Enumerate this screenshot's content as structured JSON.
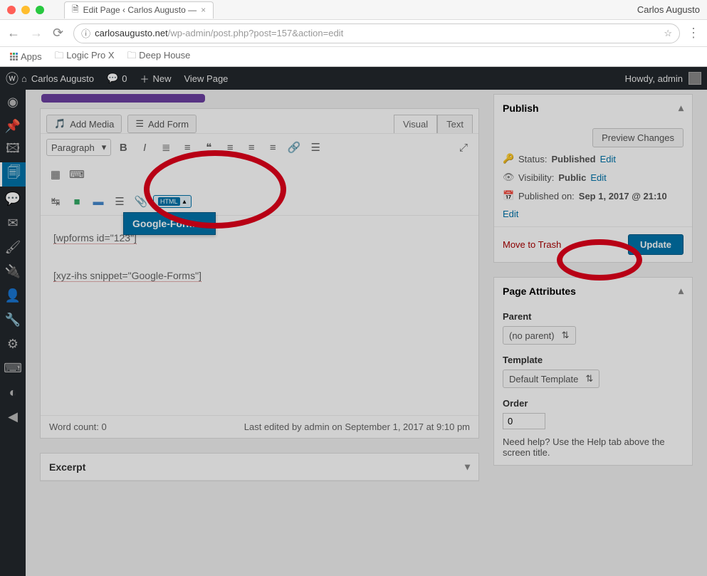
{
  "browser": {
    "tab_title": "Edit Page ‹ Carlos Augusto —",
    "user": "Carlos Augusto",
    "url_host": "carlosaugusto.net",
    "url_path": "/wp-admin/post.php?post=157&action=edit",
    "bookmarks": {
      "apps": "Apps",
      "bm1": "Logic Pro X",
      "bm2": "Deep House"
    }
  },
  "wp_bar": {
    "site": "Carlos Augusto",
    "comments": "0",
    "new": "New",
    "view": "View Page",
    "howdy": "Howdy, admin"
  },
  "editor": {
    "add_media": "Add Media",
    "add_form": "Add Form",
    "tab_visual": "Visual",
    "tab_text": "Text",
    "format": "Paragraph",
    "snippet_badge": "HTML",
    "dropdown_item": "Google-Forms",
    "content_line1": "[wpforms id=\"123\"]",
    "content_line2": "[xyz-ihs snippet=\"Google-Forms\"]",
    "word_count": "Word count: 0",
    "last_edit": "Last edited by admin on September 1, 2017 at 9:10 pm",
    "excerpt": "Excerpt"
  },
  "publish": {
    "title": "Publish",
    "preview": "Preview Changes",
    "status_l": "Status:",
    "status_v": "Published",
    "status_e": "Edit",
    "vis_l": "Visibility:",
    "vis_v": "Public",
    "vis_e": "Edit",
    "pub_l": "Published on:",
    "pub_v": "Sep 1, 2017 @ 21:10",
    "pub_e": "Edit",
    "trash": "Move to Trash",
    "update": "Update"
  },
  "attrs": {
    "title": "Page Attributes",
    "parent_l": "Parent",
    "parent_v": "(no parent)",
    "tmpl_l": "Template",
    "tmpl_v": "Default Template",
    "order_l": "Order",
    "order_v": "0",
    "help": "Need help? Use the Help tab above the screen title."
  }
}
